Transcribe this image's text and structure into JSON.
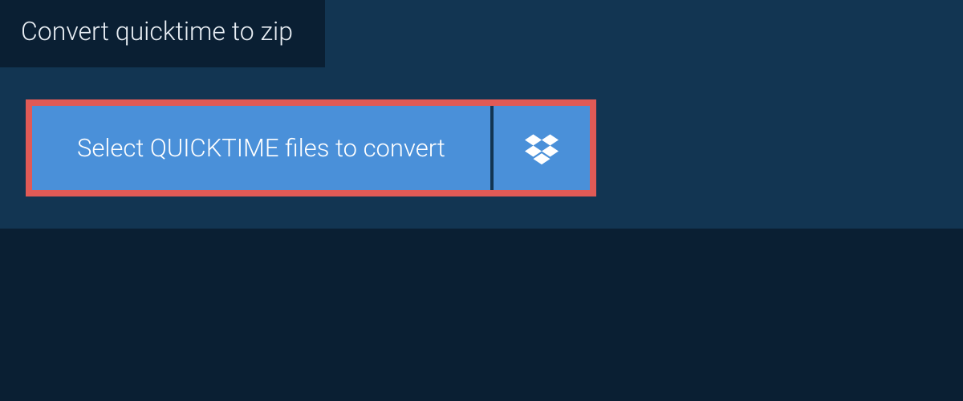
{
  "header": {
    "title": "Convert quicktime to zip"
  },
  "actions": {
    "select_files_label": "Select QUICKTIME files to convert"
  },
  "colors": {
    "background": "#0a1f33",
    "panel": "#123552",
    "button": "#4a90d9",
    "highlight_border": "#e05a56"
  }
}
